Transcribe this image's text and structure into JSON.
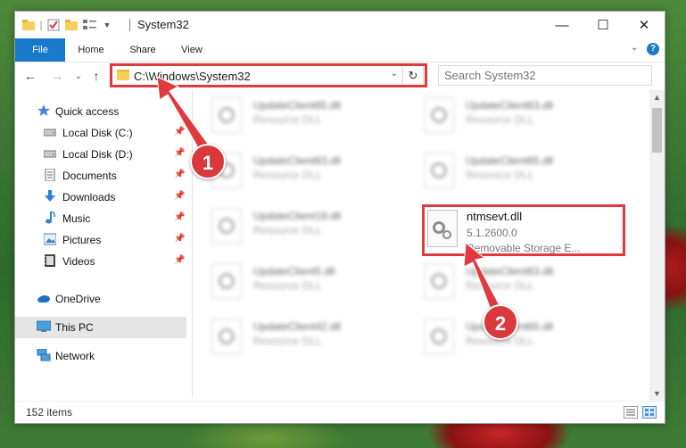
{
  "window": {
    "title": "System32",
    "controls": {
      "minimize": "—",
      "maximize": "☐",
      "close": "✕"
    }
  },
  "ribbon": {
    "tabs": [
      "File",
      "Home",
      "Share",
      "View"
    ],
    "help": "?"
  },
  "nav": {
    "back": "←",
    "forward": "→",
    "recent": "⌄",
    "up": "↑",
    "address": "C:\\Windows\\System32",
    "refresh": "↻",
    "search_placeholder": "Search System32"
  },
  "sidebar": {
    "items": [
      {
        "label": "Quick access",
        "icon": "star-icon",
        "pinned": false
      },
      {
        "label": "Local Disk (C:)",
        "icon": "drive-icon",
        "pinned": true
      },
      {
        "label": "Local Disk (D:)",
        "icon": "drive-icon",
        "pinned": true
      },
      {
        "label": "Documents",
        "icon": "documents-icon",
        "pinned": true
      },
      {
        "label": "Downloads",
        "icon": "download-icon",
        "pinned": true
      },
      {
        "label": "Music",
        "icon": "music-icon",
        "pinned": true
      },
      {
        "label": "Pictures",
        "icon": "pictures-icon",
        "pinned": true
      },
      {
        "label": "Videos",
        "icon": "videos-icon",
        "pinned": true
      },
      {
        "label": "OneDrive",
        "icon": "cloud-icon",
        "pinned": false
      },
      {
        "label": "This PC",
        "icon": "computer-icon",
        "pinned": false,
        "selected": true
      },
      {
        "label": "Network",
        "icon": "network-icon",
        "pinned": false
      }
    ]
  },
  "files": {
    "left": [
      {
        "name": "UpdateClient65.dll",
        "type": "Resource DLL"
      },
      {
        "name": "UpdateClient63.dll",
        "type": "Resource DLL"
      },
      {
        "name": "UpdateClient19.dll",
        "type": "Resource DLL"
      },
      {
        "name": "UpdateClient5.dll",
        "type": "Resource DLL"
      },
      {
        "name": "UpdateClient42.dll",
        "type": "Resource DLL"
      }
    ],
    "right": [
      {
        "name": "UpdateClient63.dll",
        "type": "Resource DLL"
      },
      {
        "name": "UpdateClient65.dll",
        "type": "Resource DLL"
      },
      {
        "name": "UpdateClient63.dll",
        "type": "Resource DLL"
      },
      {
        "name": "UpdateClient65.dll",
        "type": "Resource DLL"
      }
    ],
    "highlighted": {
      "name": "ntmsevt.dll",
      "version": "5.1.2600.0",
      "description": "Removable Storage E..."
    }
  },
  "status": {
    "count": "152 items"
  },
  "annotations": {
    "step1": "1",
    "step2": "2",
    "highlight_color": "#e0393e"
  }
}
